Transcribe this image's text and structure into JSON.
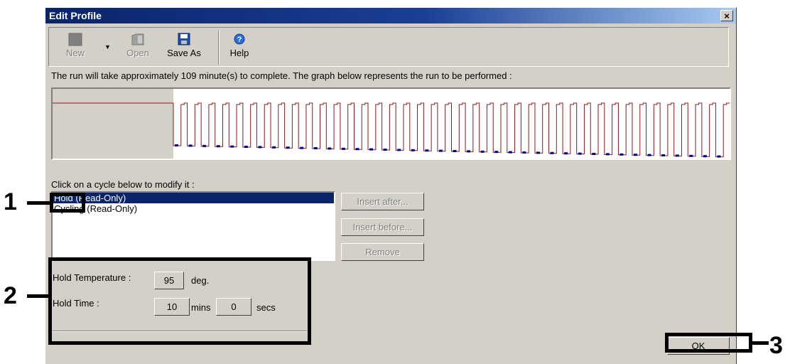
{
  "window": {
    "title": "Edit Profile",
    "close_label": "×"
  },
  "toolbar": {
    "new_label": "New",
    "open_label": "Open",
    "save_as_label": "Save As",
    "help_label": "Help"
  },
  "info": {
    "text": "The run will take approximately 109 minute(s) to complete. The graph below represents the run to be performed :"
  },
  "chart_data": {
    "type": "line",
    "title": "",
    "segments": [
      {
        "name": "Hold",
        "temperature": 95,
        "duration_min": 10
      },
      {
        "name": "Cycling",
        "cycles": 40
      }
    ],
    "colors": {
      "line": "#8b1a1a",
      "marker": "#00008b",
      "hold_region": "#d4d0c8"
    }
  },
  "cycle_section": {
    "prompt": "Click on a cycle below to modify it :",
    "items": [
      {
        "label": "Hold (Read-Only)",
        "selected": true
      },
      {
        "label": "Cycling (Read-Only)",
        "selected": false
      }
    ],
    "insert_after_label": "Insert after...",
    "insert_before_label": "Insert before...",
    "remove_label": "Remove"
  },
  "hold": {
    "temperature_label": "Hold Temperature :",
    "temperature_value": "95",
    "temperature_unit": "deg.",
    "time_label": "Hold Time :",
    "time_mins": "10",
    "mins_unit": "mins",
    "time_secs": "0",
    "secs_unit": "secs"
  },
  "ok_label": "OK",
  "annotations": {
    "one": "1",
    "two": "2",
    "three": "3"
  }
}
